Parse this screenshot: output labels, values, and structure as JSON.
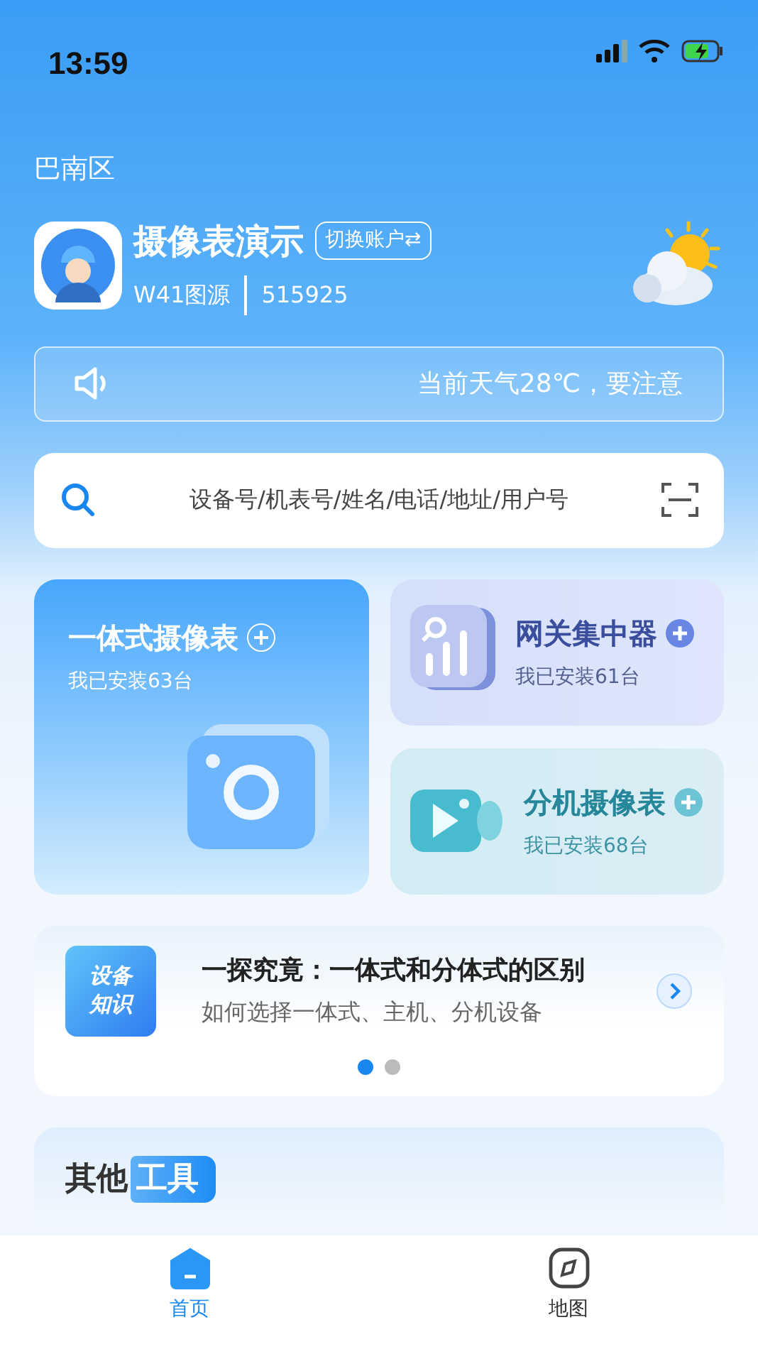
{
  "status_bar": {
    "time": "13:59"
  },
  "district": "巴南区",
  "account": {
    "name": "摄像表演示",
    "switch_label": "切换账户⇄",
    "source": "W41图源",
    "code": "515925"
  },
  "notice": {
    "text": "当前天气28℃，要注意"
  },
  "search": {
    "placeholder": "设备号/机表号/姓名/电话/地址/用户号"
  },
  "tiles": [
    {
      "kind": "large",
      "title": "一体式摄像表",
      "subtitle": "我已安装63台"
    },
    {
      "kind": "small",
      "title": "网关集中器",
      "subtitle": "我已安装61台"
    },
    {
      "kind": "small",
      "title": "分机摄像表",
      "subtitle": "我已安装68台"
    }
  ],
  "article": {
    "badge_lines": [
      "设备",
      "知识"
    ],
    "title": "一探究竟：一体式和分体式的区别",
    "subtitle": "如何选择一体式、主机、分机设备",
    "dots": [
      {
        "selected": true
      },
      {
        "selected": false
      }
    ]
  },
  "tools": {
    "title": "其他",
    "title_highlight": "工具"
  },
  "tab_bar": [
    {
      "label": "首页",
      "selected": true
    },
    {
      "label": "地图",
      "selected": false
    }
  ]
}
